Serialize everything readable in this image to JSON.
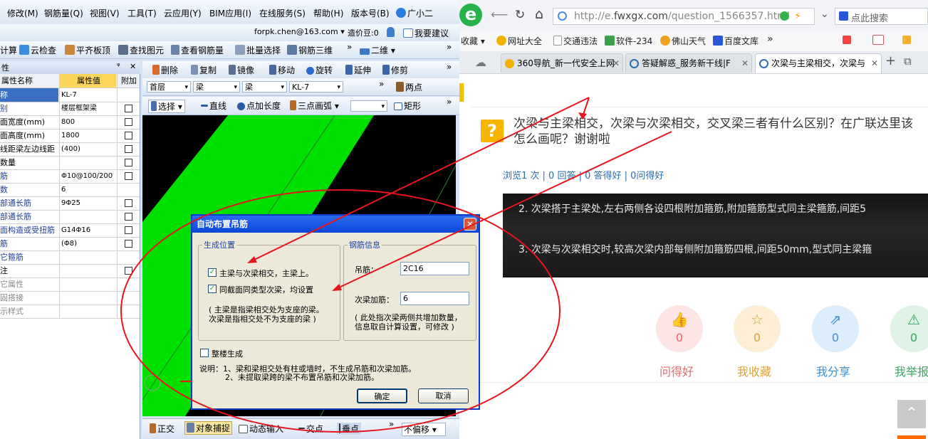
{
  "colors": {
    "annotation": "#e8141e",
    "green": "#00e000",
    "dialog_title": "#0a46d8",
    "link": "#2a6db5"
  },
  "app": {
    "menu": [
      "修改(M)",
      "钢筋量(Q)",
      "视图(V)",
      "工具(T)",
      "云应用(Y)",
      "BIM应用(I)",
      "在线服务(S)",
      "帮助(H)",
      "版本号(B)",
      "广小二"
    ],
    "account": "forpk.chen@163.com",
    "account_arrow": "▾",
    "coins": "造价豆:0",
    "suggest": "我要建议",
    "toolbar1": [
      "计算",
      "云检查",
      "平齐板顶",
      "查找图元",
      "查看钢筋量",
      "批量选择",
      "钢筋三维",
      "二维"
    ],
    "toolbar2": [
      "删除",
      "复制",
      "镜像",
      "移动",
      "旋转",
      "延伸",
      "修剪"
    ],
    "toolbar3": {
      "floor": "首层",
      "cat": "梁",
      "sub": "梁",
      "name": "KL-7",
      "two_point": "两点"
    },
    "toolbar4": [
      "选择",
      "直线",
      "点加长度",
      "三点画弧",
      "矩形"
    ],
    "more": "»",
    "prop_panel": {
      "pin": "ᵠ",
      "close": "✕",
      "pin_title": "性",
      "header": {
        "name": "属性名称",
        "value": "属性值",
        "extra": "附加"
      },
      "rows": [
        {
          "name": "称",
          "value": "KL-7",
          "style": "blue",
          "sel": true
        },
        {
          "name": "别",
          "value": "楼层框架梁",
          "style": "blue"
        },
        {
          "name": "面宽度(mm)",
          "value": "800",
          "style": ""
        },
        {
          "name": "面高度(mm)",
          "value": "1800",
          "style": ""
        },
        {
          "name": "线距梁左边线距",
          "value": "(400)",
          "style": ""
        },
        {
          "name": "数量",
          "value": "",
          "style": ""
        },
        {
          "name": "筋",
          "value": "Φ10@100/200",
          "style": "blue"
        },
        {
          "name": "数",
          "value": "6",
          "style": "blue"
        },
        {
          "name": "部通长筋",
          "value": "9Φ25",
          "style": "blue"
        },
        {
          "name": "部通长筋",
          "value": "",
          "style": "blue"
        },
        {
          "name": "面构造或受扭筋",
          "value": "G14Φ16",
          "style": "blue"
        },
        {
          "name": "筋",
          "value": "(Φ8)",
          "style": "blue"
        },
        {
          "name": "它箍筋",
          "value": "",
          "style": "blue"
        },
        {
          "name": "注",
          "value": "",
          "style": ""
        },
        {
          "name": "它属性",
          "value": "",
          "style": "gray"
        },
        {
          "name": "固搭接",
          "value": "",
          "style": "gray"
        },
        {
          "name": "示样式",
          "value": "",
          "style": "gray"
        }
      ]
    },
    "status": [
      "正交",
      "对象捕捉",
      "动态输入",
      "交点",
      "垂点",
      "不偏移"
    ]
  },
  "dialog": {
    "title": "自动布置吊筋",
    "close": "✕",
    "pos_group": "生成位置",
    "rebar_group": "钢筋信息",
    "opt1": "主梁与次梁相交，主梁上。",
    "opt2": "同截面同类型次梁，均设置",
    "note1": "( 主梁是指梁相交处为支座的梁。",
    "note2": "次梁是指相交处不为支座的梁 )",
    "hanger_label": "吊筋：",
    "hanger_value": "2C16",
    "stirrup_label": "次梁加筋：",
    "stirrup_value": "6",
    "info1": "( 此处指次梁两侧共增加数量，",
    "info2": "信息取自计算设置，可修改 )",
    "whole": "整楼生成",
    "desc1": "说明：1、梁和梁相交处有柱或墙时，不生成吊筋和次梁加筋。",
    "desc2": "2、未提取梁跨的梁不布置吊筋和次梁加筋。",
    "ok": "确定",
    "cancel": "取消",
    "check": "✓"
  },
  "browser": {
    "logo": "e",
    "url_pre": "http://e.",
    "url_host": "fwxgx.com",
    "url_post": "/question_1566357.html",
    "search": "点此搜索",
    "bookmarks": [
      "收藏",
      "网址大全",
      "交通违法",
      "软件-234",
      "佛山天气",
      "百度文库"
    ],
    "nav": {
      "back": "⟵",
      "forward": "⟶",
      "reload": "↻",
      "home": "⌂",
      "chev": "»",
      "menu": "⌄",
      "new": "+",
      "restore": "⧉"
    },
    "tabs": [
      {
        "label": "360导航_新一代安全上网",
        "close": "✕"
      },
      {
        "label": "答疑解惑_服务新干线|F",
        "close": "✕"
      },
      {
        "label": "次梁与主梁相交，次梁与",
        "close": "✕"
      }
    ],
    "question": {
      "icon": "?",
      "title": "次梁与主梁相交，次梁与次梁相交，交叉梁三者有什么区别？在广联达里该怎么画呢？谢谢啦",
      "stats": "浏览1 次 | 0 回答 | 0 答得好 | 0问得好",
      "img_line1": "2. 次梁搭于主梁处,左右两侧各设四根附加箍筋,附加箍筋型式同主梁箍筋,间距5",
      "img_line2": "3. 次梁与次梁相交时,较高次梁内部每侧附加箍筋四根,间距50mm,型式同主梁箍"
    },
    "actions": [
      {
        "label": "问得好",
        "count": "0",
        "icon": "👍",
        "color": "#e8686e",
        "bg": "#fde4e5"
      },
      {
        "label": "我收藏",
        "count": "0",
        "icon": "☆",
        "color": "#dca13a",
        "bg": "#fcefd6"
      },
      {
        "label": "我分享",
        "count": "0",
        "icon": "⇗",
        "color": "#3c8fd4",
        "bg": "#dcedfb"
      },
      {
        "label": "我举报",
        "count": "0",
        "icon": "⚠",
        "color": "#36a862",
        "bg": "#dff3e6"
      }
    ],
    "totop": "⌃"
  }
}
